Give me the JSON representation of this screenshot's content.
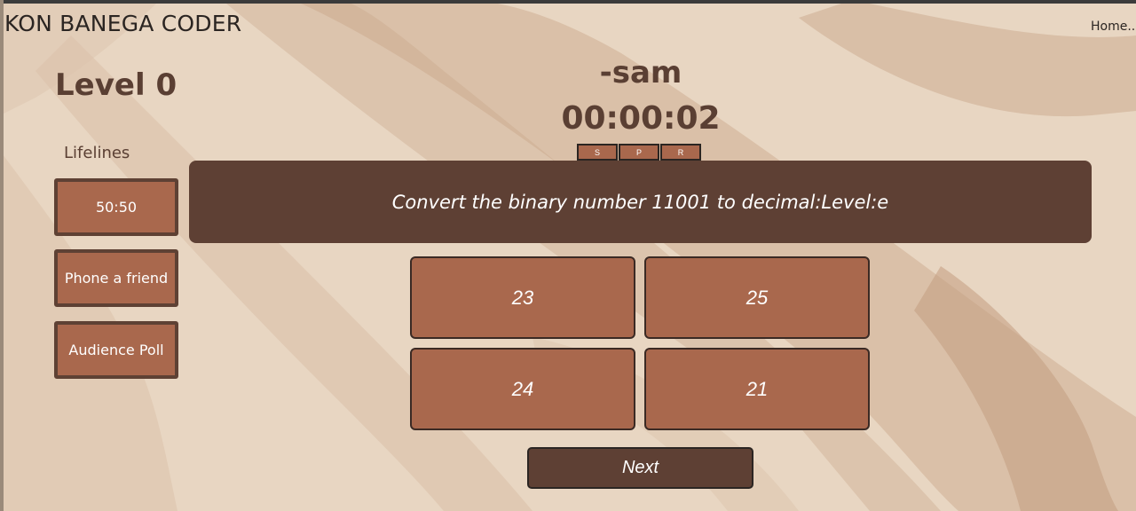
{
  "header": {
    "brand": "KON BANEGA CODER",
    "home_link": "Home..."
  },
  "level_label": "Level 0",
  "lifelines": {
    "title": "Lifelines",
    "items": [
      {
        "label": "50:50"
      },
      {
        "label": "Phone a friend"
      },
      {
        "label": "Audience Poll"
      }
    ]
  },
  "player_name": "-sam",
  "timer": {
    "time": "00:00:02",
    "controls": [
      {
        "label": "S"
      },
      {
        "label": "P"
      },
      {
        "label": "R"
      }
    ]
  },
  "question": "Convert the binary number 11001 to decimal:Level:e",
  "options": [
    {
      "label": "23"
    },
    {
      "label": "25"
    },
    {
      "label": "24"
    },
    {
      "label": "21"
    }
  ],
  "next_label": "Next",
  "colors": {
    "background": "#e6d2bd",
    "accent": "#a9684d",
    "dark": "#5e4034",
    "text": "#5a3f33"
  }
}
